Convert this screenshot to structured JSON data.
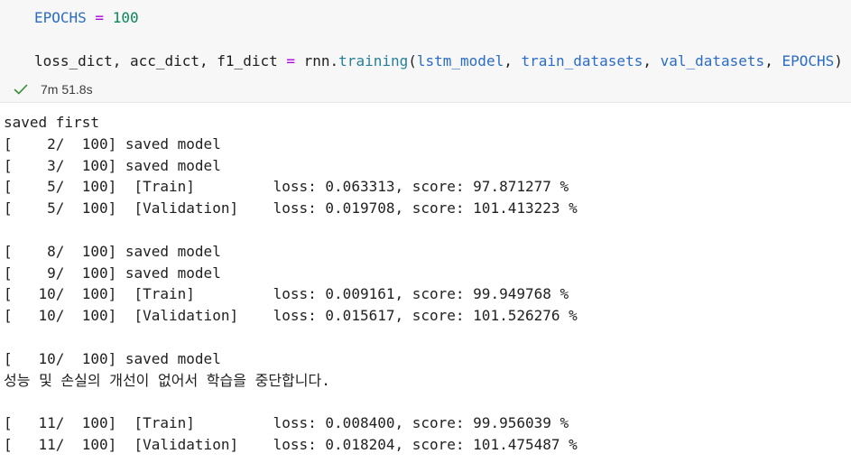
{
  "cell": {
    "line1": {
      "var": "EPOCHS",
      "op": " = ",
      "num": "100"
    },
    "line2": {
      "lhs": "loss_dict, acc_dict, f1_dict",
      "op": " = ",
      "obj": "rnn",
      "dot": ".",
      "fn": "training",
      "open": "(",
      "arg1": "lstm_model",
      "sep1": ", ",
      "arg2": "train_datasets",
      "sep2": ", ",
      "arg3": "val_datasets",
      "sep3": ", ",
      "arg4": "EPOCHS",
      "close": ")"
    }
  },
  "status": {
    "icon": "check-icon",
    "exec_time": "7m 51.8s",
    "check_color": "#388a34"
  },
  "output": {
    "lines": [
      "saved first",
      "[    2/  100] saved model",
      "[    3/  100] saved model",
      "[    5/  100]  [Train]         loss: 0.063313, score: 97.871277 %",
      "[    5/  100]  [Validation]    loss: 0.019708, score: 101.413223 %",
      "",
      "[    8/  100] saved model",
      "[    9/  100] saved model",
      "[   10/  100]  [Train]         loss: 0.009161, score: 99.949768 %",
      "[   10/  100]  [Validation]    loss: 0.015617, score: 101.526276 %",
      "",
      "[   10/  100] saved model",
      "성능 및 손실의 개선이 없어서 학습을 중단합니다.",
      "",
      "[   11/  100]  [Train]         loss: 0.008400, score: 99.956039 %",
      "[   11/  100]  [Validation]    loss: 0.018204, score: 101.475487 %"
    ]
  }
}
